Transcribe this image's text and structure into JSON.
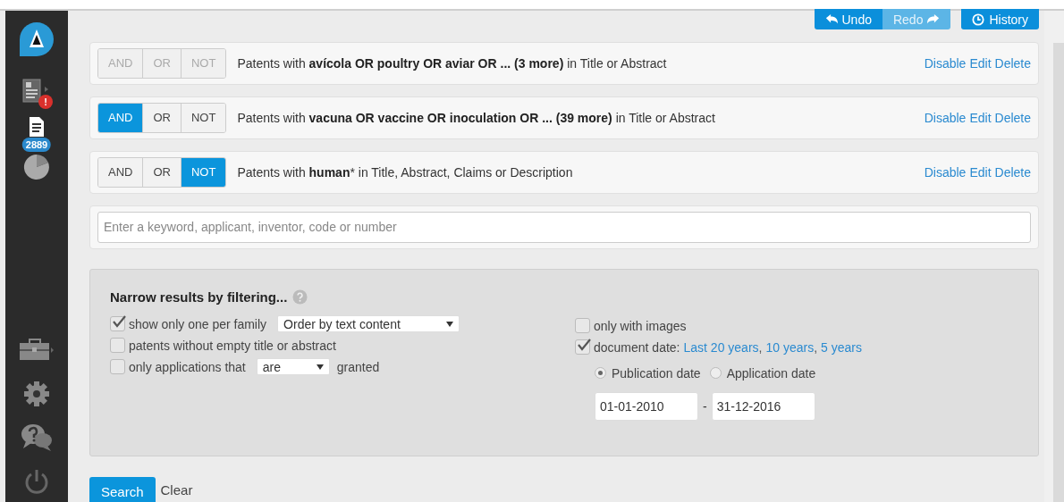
{
  "sidebar": {
    "logo": {
      "kind": "logo"
    },
    "top_items": [
      {
        "kind": "report",
        "badge": "!"
      },
      {
        "kind": "document",
        "badge": "2889"
      },
      {
        "kind": "pie"
      }
    ],
    "bottom_items": [
      {
        "kind": "toolbox"
      },
      {
        "kind": "gear"
      },
      {
        "kind": "help"
      },
      {
        "kind": "power"
      }
    ]
  },
  "toolbar": {
    "buttons": [
      {
        "kind": "undo",
        "label": "Undo",
        "disabled": false
      },
      {
        "kind": "redo",
        "label": "Redo",
        "disabled": true
      },
      {
        "kind": "history",
        "label": "History",
        "disabled": false
      }
    ]
  },
  "queries": [
    {
      "disabled": true,
      "operators": [
        {
          "label": "AND",
          "selected": false
        },
        {
          "label": "OR",
          "selected": false
        },
        {
          "label": "NOT",
          "selected": false
        }
      ],
      "text": "Patents with **avícola OR poultry OR aviar OR ... (3 more)** in Title or Abstract",
      "actions": [
        "Disable",
        "Edit",
        "Delete"
      ]
    },
    {
      "disabled": false,
      "operators": [
        {
          "label": "AND",
          "selected": true
        },
        {
          "label": "OR",
          "selected": false
        },
        {
          "label": "NOT",
          "selected": false
        }
      ],
      "text": "Patents with **vacuna OR vaccine OR inoculation OR ... (39 more)** in Title or Abstract",
      "actions": [
        "Disable",
        "Edit",
        "Delete"
      ]
    },
    {
      "disabled": false,
      "operators": [
        {
          "label": "AND",
          "selected": false
        },
        {
          "label": "OR",
          "selected": false
        },
        {
          "label": "NOT",
          "selected": true
        }
      ],
      "text": "Patents with **human*** in Title, Abstract, Claims or Description",
      "actions": [
        "Disable",
        "Edit",
        "Delete"
      ]
    }
  ],
  "search": {
    "placeholder": "Enter a keyword, applicant, inventor, code or number"
  },
  "filters": {
    "title": "Narrow results by filtering...",
    "left": [
      {
        "label": "show only one per family",
        "checked": true,
        "select": "Order by text content"
      },
      {
        "label": "patents without empty title or abstract",
        "checked": false
      },
      {
        "label": "only applications that",
        "checked": false,
        "select": "are",
        "suffix": "granted"
      }
    ],
    "right": [
      {
        "label": "only with images",
        "checked": false
      },
      {
        "label": "document date:",
        "checked": true,
        "links": [
          "Last 20 years",
          "10 years",
          "5 years"
        ],
        "link_separator": ","
      }
    ],
    "date_type": [
      {
        "label": "Publication date",
        "selected": true
      },
      {
        "label": "Application date",
        "selected": false
      }
    ],
    "date_range": {
      "from": "01-01-2010",
      "separator": "-",
      "to": "31-12-2016"
    }
  },
  "actions": [
    {
      "kind": "primary",
      "label": "Search"
    },
    {
      "kind": "plain",
      "label": "Clear"
    }
  ]
}
